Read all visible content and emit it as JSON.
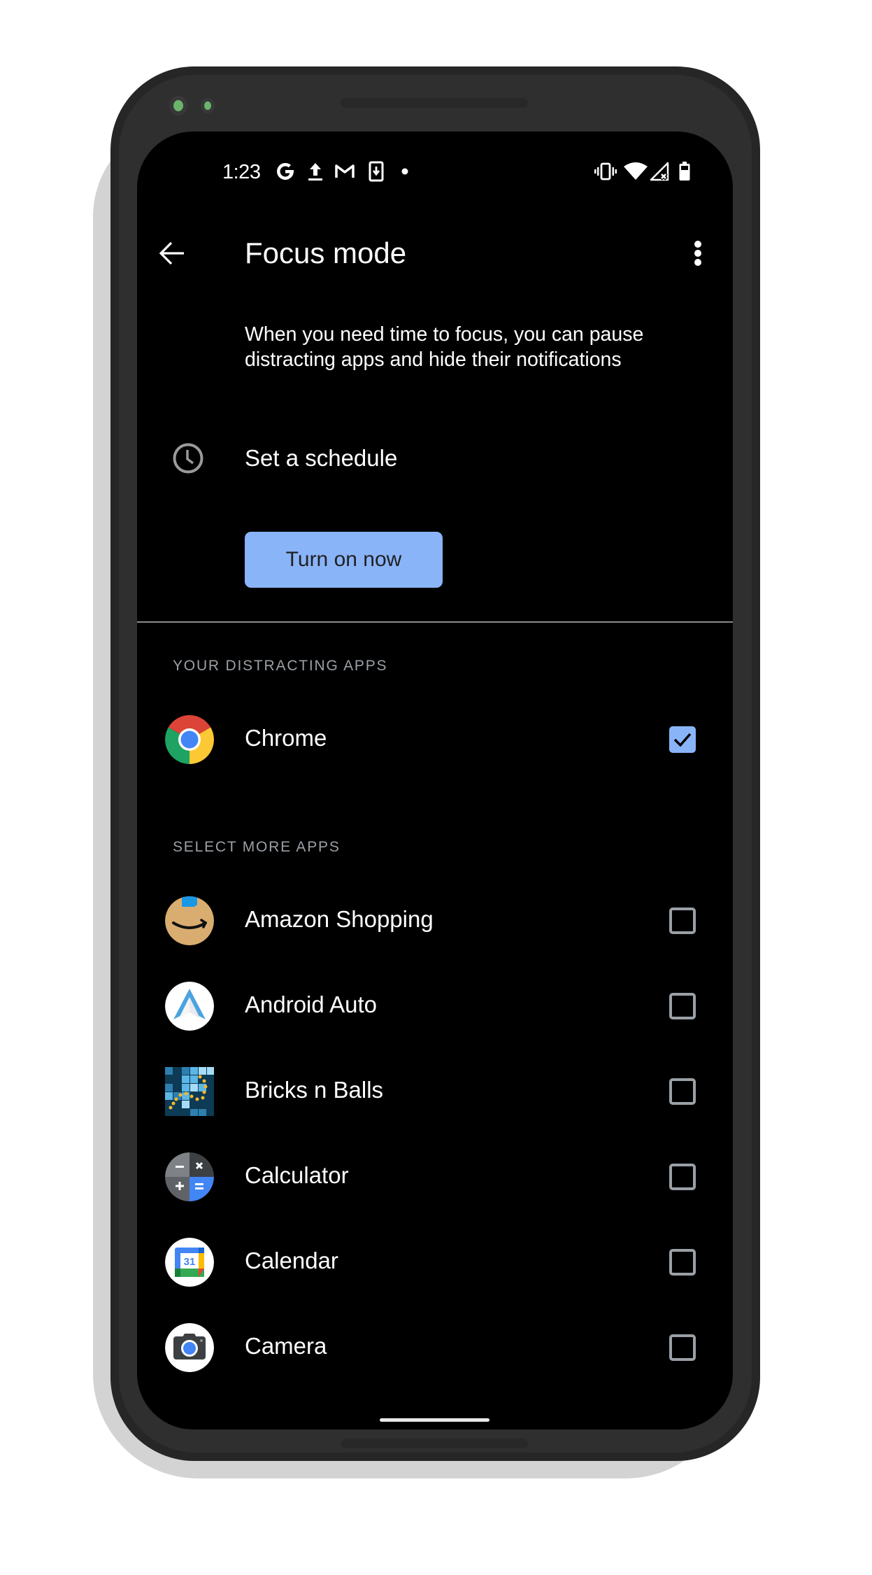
{
  "status_bar": {
    "time": "1:23",
    "left_icons": [
      "google-icon",
      "upload-icon",
      "gmail-icon",
      "download-to-phone-icon",
      "dot-icon"
    ],
    "right_icons": [
      "vibrate-icon",
      "wifi-icon",
      "no-signal-icon",
      "battery-icon"
    ]
  },
  "app_bar": {
    "title": "Focus mode",
    "back_icon": "arrow-back-icon",
    "more_icon": "more-vert-icon"
  },
  "description": "When you need time to focus, you can pause distracting apps and hide their notifications",
  "schedule": {
    "label": "Set a schedule",
    "icon": "clock-icon"
  },
  "turn_on_button": {
    "label": "Turn on now",
    "color": "#8ab4f8"
  },
  "sections": {
    "distracting": {
      "header": "YOUR DISTRACTING APPS",
      "apps": [
        {
          "name": "Chrome",
          "icon": "chrome-icon",
          "checked": true
        }
      ]
    },
    "more": {
      "header": "SELECT MORE APPS",
      "apps": [
        {
          "name": "Amazon Shopping",
          "icon": "amazon-icon",
          "checked": false
        },
        {
          "name": "Android Auto",
          "icon": "android-auto-icon",
          "checked": false
        },
        {
          "name": "Bricks n Balls",
          "icon": "bricks-n-balls-icon",
          "checked": false
        },
        {
          "name": "Calculator",
          "icon": "calculator-icon",
          "checked": false
        },
        {
          "name": "Calendar",
          "icon": "calendar-icon",
          "checked": false,
          "badge": "31"
        },
        {
          "name": "Camera",
          "icon": "camera-icon",
          "checked": false
        }
      ]
    }
  },
  "colors": {
    "accent": "#8ab4f8",
    "background": "#000000",
    "section_header": "#9aa0a6",
    "checkbox_unchecked": "#9aa0a6"
  }
}
